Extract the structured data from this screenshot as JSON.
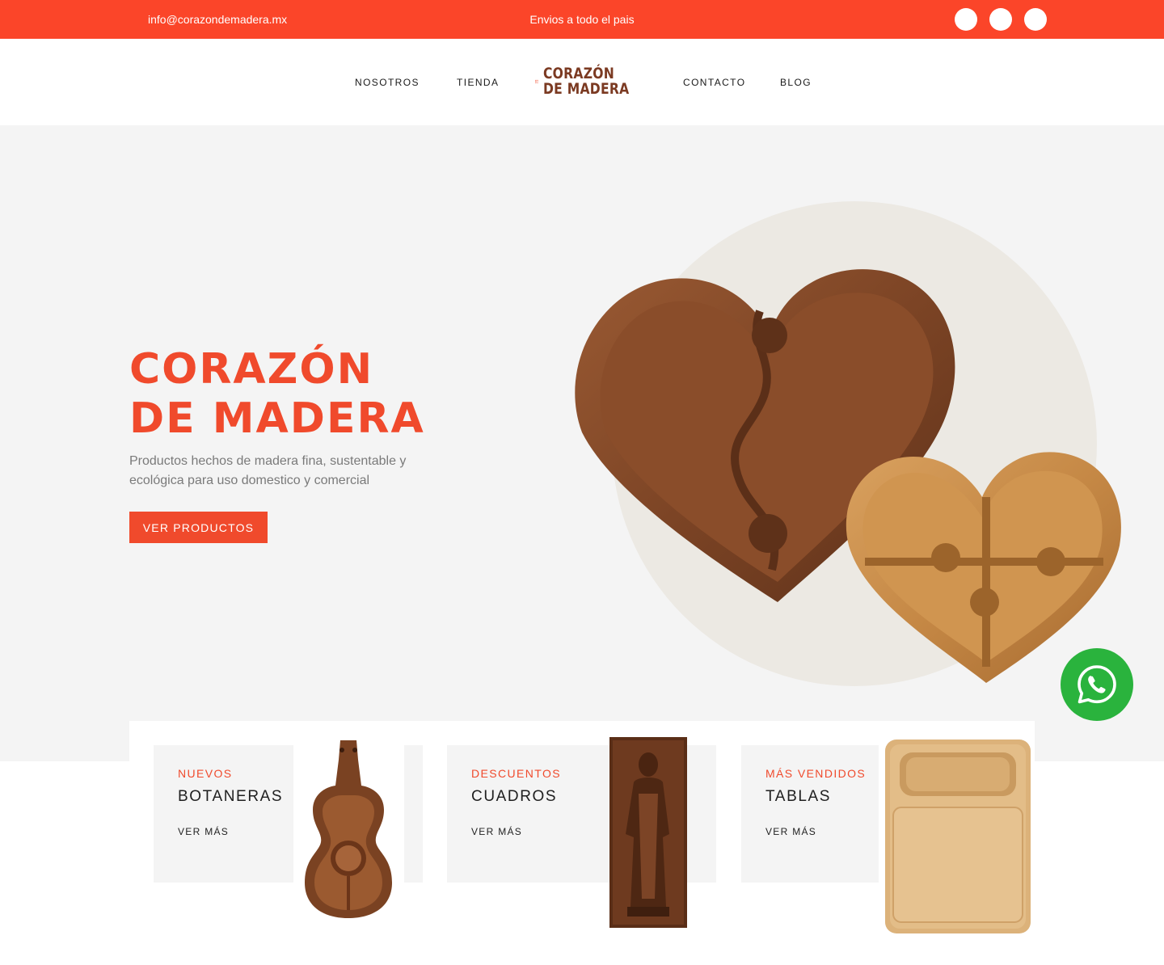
{
  "topbar": {
    "email": "info@corazondemadera.mx",
    "shipping": "Envios a todo el pais",
    "social_icons": [
      "social-icon-1",
      "social-icon-2",
      "social-icon-3"
    ]
  },
  "nav": {
    "left": [
      "NOSOTROS",
      "TIENDA"
    ],
    "right": [
      "CONTACTO",
      "BLOG"
    ]
  },
  "logo": {
    "line1": "CORAZÓN",
    "line2": "DE MADERA"
  },
  "hero": {
    "title_line1": "CORAZÓN",
    "title_line2": "DE MADERA",
    "subtitle": "Productos hechos de madera fina, sustentable y ecológica para uso domestico y comercial",
    "button": "VER PRODUCTOS"
  },
  "categories": [
    {
      "tag": "NUEVOS",
      "name": "BOTANERAS",
      "link": "VER MÁS",
      "image": "guitar-tray-image"
    },
    {
      "tag": "DESCUENTOS",
      "name": "CUADROS",
      "link": "VER MÁS",
      "image": "carved-figure-image"
    },
    {
      "tag": "MÁS VENDIDOS",
      "name": "TABLAS",
      "link": "VER MÁS",
      "image": "cutting-board-image"
    }
  ],
  "colors": {
    "brand": "#fb4529",
    "logo_brown": "#7b3a22",
    "whatsapp": "#2ab33d",
    "hero_bg": "#f4f4f4"
  }
}
